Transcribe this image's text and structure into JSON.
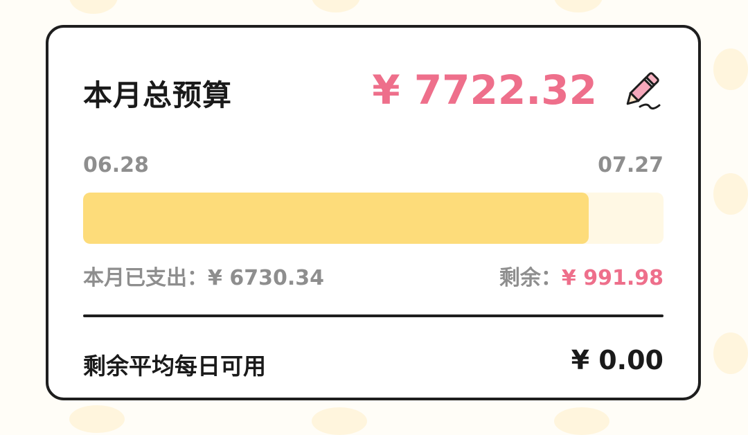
{
  "budget": {
    "title": "本月总预算",
    "total_amount": "¥ 7722.32",
    "edit_icon": "pencil-icon"
  },
  "period": {
    "start_date": "06.28",
    "end_date": "07.27"
  },
  "progress": {
    "spent_fraction": 0.871,
    "fill_color": "#fddc7a",
    "track_color": "#fff8e4"
  },
  "spending": {
    "spent_text": "本月已支出：¥ 6730.34",
    "remaining_label": "剩余：",
    "remaining_value": "¥ 991.98"
  },
  "daily": {
    "label": "剩余平均每日可用",
    "value": "¥ 0.00"
  },
  "colors": {
    "accent_pink": "#ee6f8b",
    "muted_gray": "#8e8e8e",
    "border": "#1e1e1e"
  }
}
